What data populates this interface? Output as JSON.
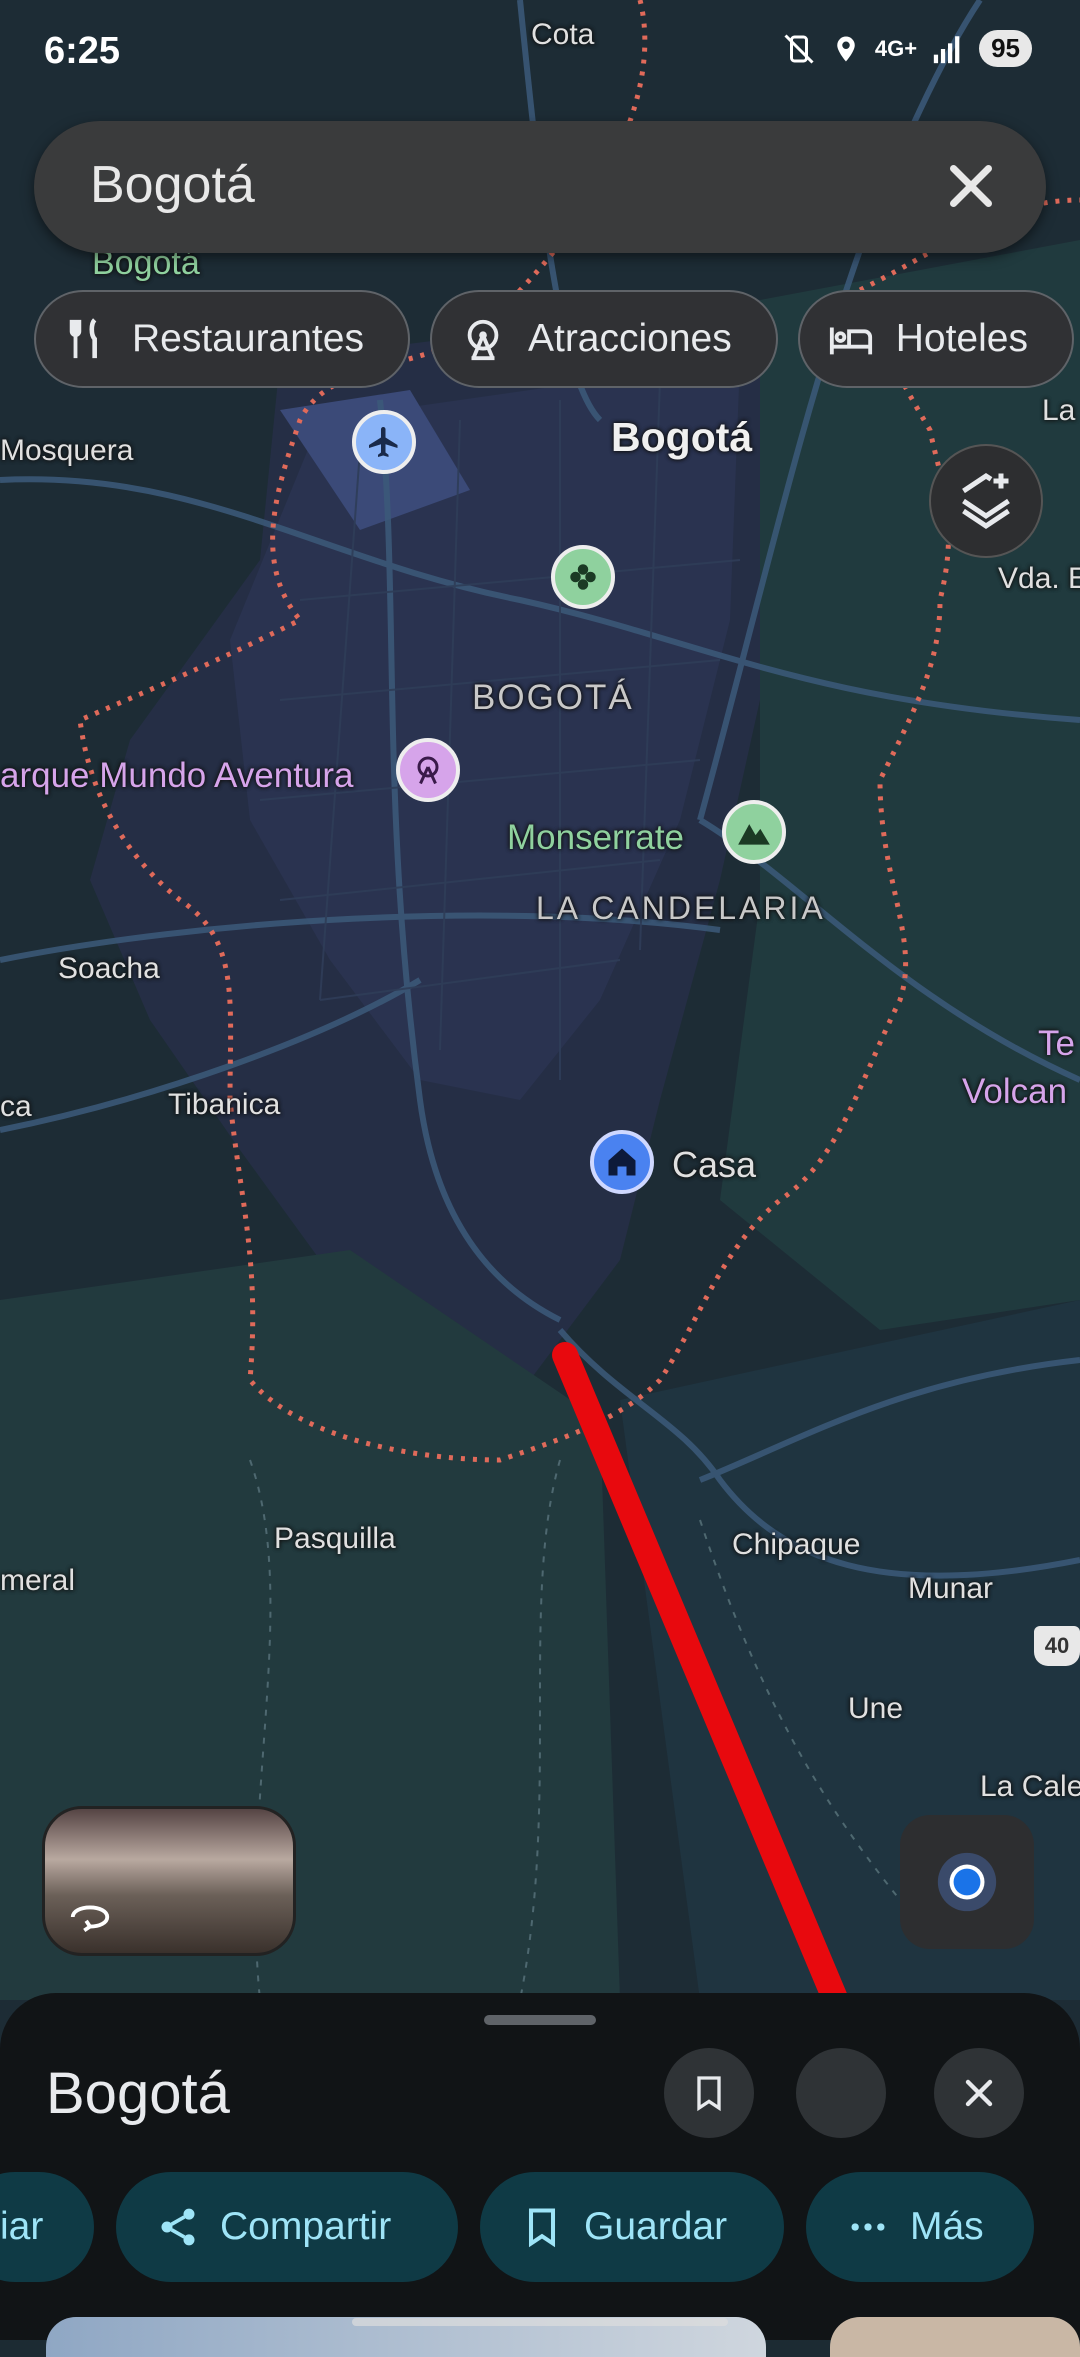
{
  "status_bar": {
    "time": "6:25",
    "network": "4G+",
    "battery": "95"
  },
  "search": {
    "query": "Bogotá"
  },
  "chips": [
    {
      "label": "Restaurantes",
      "icon": "fork-knife-icon"
    },
    {
      "label": "Atracciones",
      "icon": "ferris-wheel-icon"
    },
    {
      "label": "Hoteles",
      "icon": "bed-icon"
    }
  ],
  "map_labels": {
    "cota": "Cota",
    "bogota_top": "Bogotá",
    "mosquera": "Mosquera",
    "la_edge": "La",
    "bogota_city": "Bogotá",
    "vda": "Vda. E",
    "bogota_district": "BOGOTÁ",
    "parque": "arque Mundo Aventura",
    "monserrate": "Monserrate",
    "candelaria": "LA CANDELARIA",
    "soacha": "Soacha",
    "te": "Te",
    "volcan": "Volcan",
    "ca": "ca",
    "tibanica": "Tibanica",
    "casa": "Casa",
    "pasquilla": "Pasquilla",
    "chipaque": "Chipaque",
    "meral": "meral",
    "munar": "Munar",
    "route": "40",
    "une": "Une",
    "la_cale": "La Cale"
  },
  "sheet": {
    "title": "Bogotá",
    "actions": [
      "iar",
      "Compartir",
      "Guardar",
      "Más"
    ]
  },
  "colors": {
    "accent": "#9ee4f7",
    "action_bg": "#0f3a45",
    "arrow": "#e8090e",
    "border": "#e06a5a"
  }
}
